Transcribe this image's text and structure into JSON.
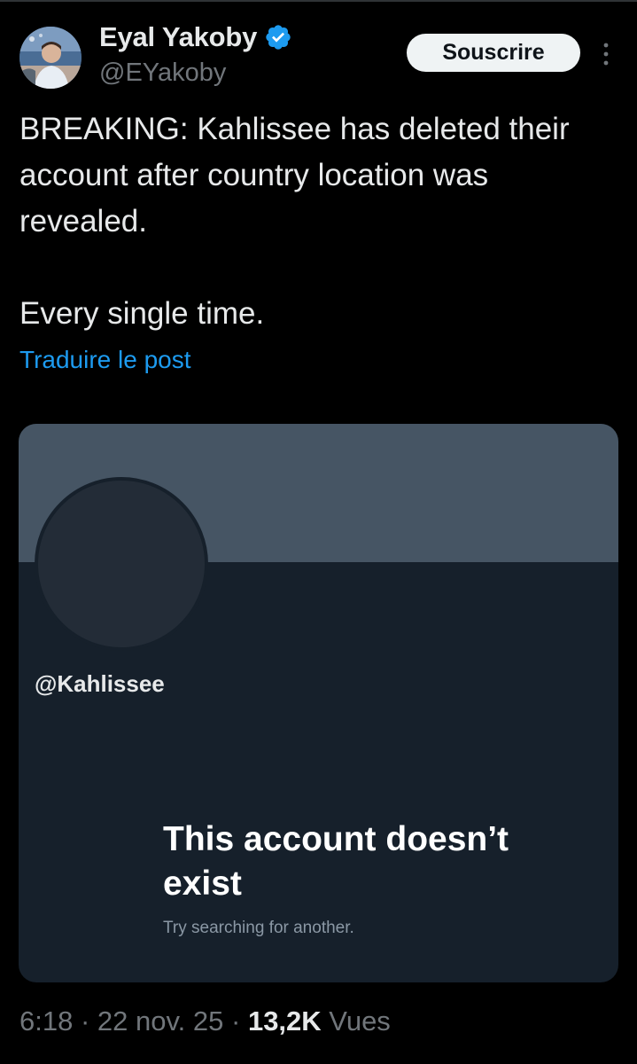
{
  "post": {
    "author": {
      "display_name": "Eyal Yakoby",
      "handle": "@EYakoby",
      "verified": true,
      "verified_color": "#1d9bf0"
    },
    "subscribe_label": "Souscrire",
    "more_icon": "vertical-ellipsis-icon",
    "text": "BREAKING: Kahlissee has deleted their account after country location was revealed.\n\nEvery single time.",
    "translate_label": "Traduire le post",
    "media": {
      "handle": "@Kahlissee",
      "title": "This account doesn’t exist",
      "subtitle": "Try searching for another."
    },
    "meta": {
      "time": "6:18",
      "separator": " · ",
      "date": "22 nov. 25",
      "views_count": "13,2K",
      "views_label": " Vues"
    }
  },
  "colors": {
    "background": "#000000",
    "text": "#e7e9ea",
    "secondary_text": "#71767b",
    "link": "#1d9bf0",
    "card_background": "#16202b",
    "card_banner": "#465564"
  }
}
